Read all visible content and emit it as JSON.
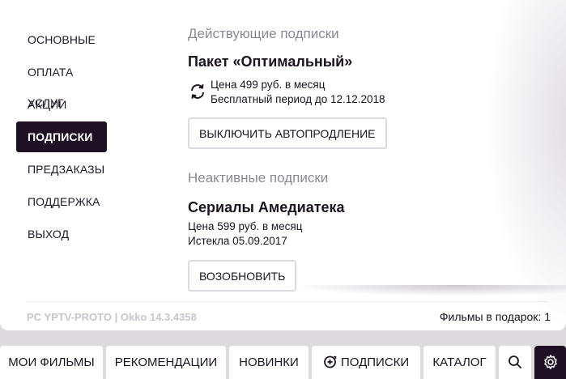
{
  "menu": {
    "items": [
      {
        "label": "ОСНОВНЫЕ"
      },
      {
        "label": "ОПЛАТА УСЛУГ"
      },
      {
        "label": "АКЦИИ"
      },
      {
        "label": "ПОДПИСКИ",
        "active": true
      },
      {
        "label": "ПРЕДЗАКАЗЫ"
      },
      {
        "label": "ПОДДЕРЖКА"
      },
      {
        "label": "ВЫХОД"
      }
    ]
  },
  "active": {
    "section_title": "Действующие подписки",
    "package_name": "Пакет «Оптимальный»",
    "price": "Цена 499 руб. в месяц",
    "trial": "Бесплатный период до 12.12.2018",
    "button": "ВЫКЛЮЧИТЬ АВТОПРОДЛЕНИЕ",
    "icon": "renew-icon"
  },
  "inactive": {
    "section_title": "Неактивные подписки",
    "name": "Сериалы Амедиатека",
    "price": "Цена 599 руб. в месяц",
    "expired": "Истекла 05.09.2017",
    "button": "ВОЗОБНОВИТЬ"
  },
  "footer": {
    "version": "PC YPTV-PROTO | Okko 14.3.4358",
    "gift_films": "Фильмы в подарок: 1"
  },
  "nav": {
    "my_films": "МОИ ФИЛЬМЫ",
    "recommendations": "РЕКОМЕНДАЦИИ",
    "new": "НОВИНКИ",
    "subscriptions": "ПОДПИСКИ",
    "catalog": "КАТАЛОГ",
    "search_icon": "search-icon",
    "settings_icon": "gear-icon"
  },
  "colors": {
    "accent_dark": "#1f1026",
    "background": "#dcdadd",
    "muted_text": "#8d8794"
  }
}
